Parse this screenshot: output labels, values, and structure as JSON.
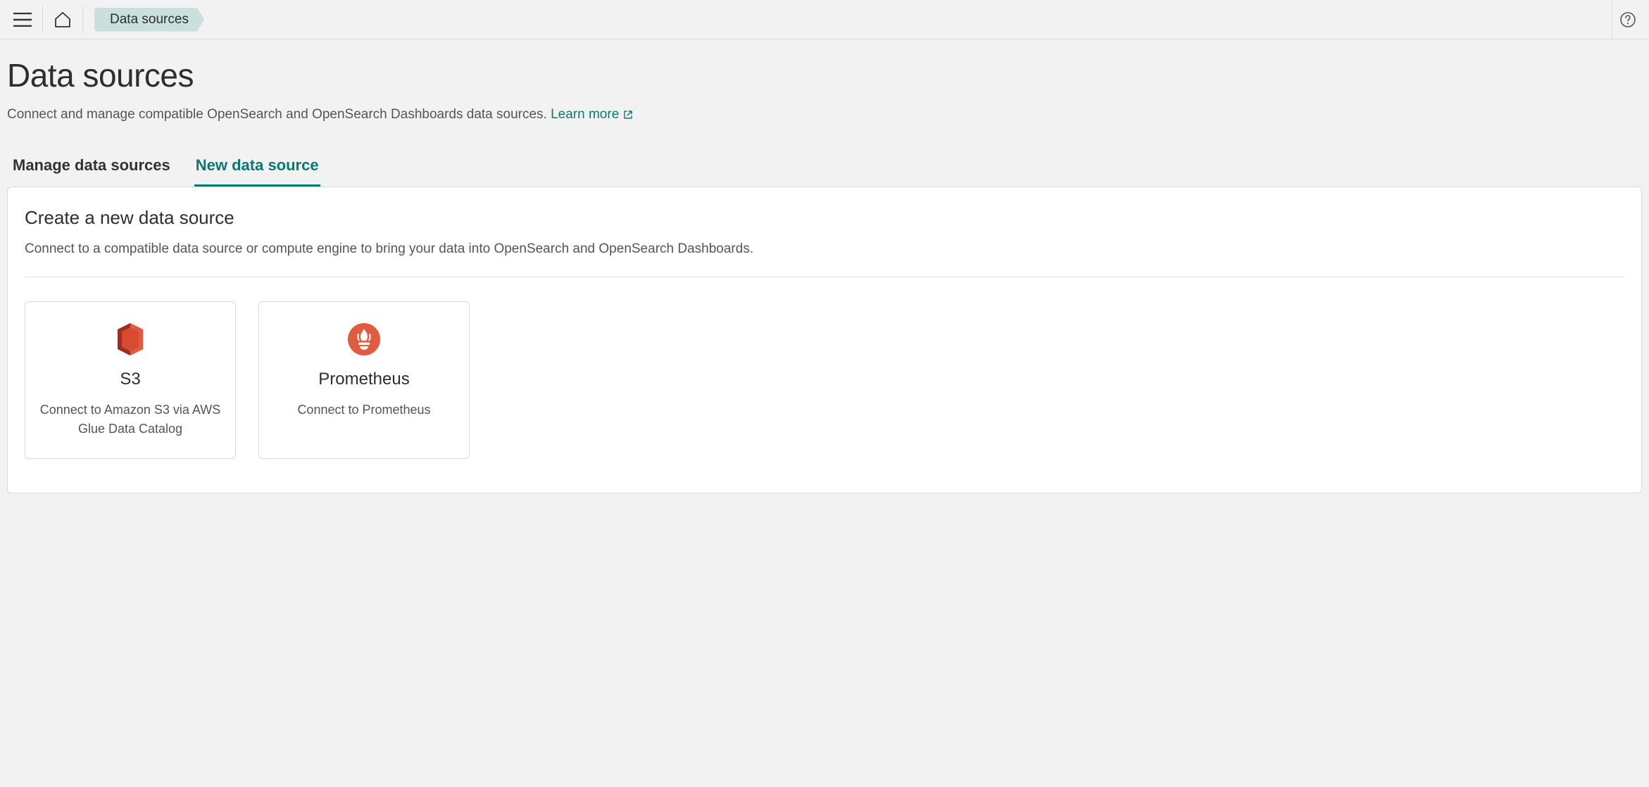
{
  "breadcrumb": {
    "current": "Data sources"
  },
  "page": {
    "title": "Data sources",
    "subtitle": "Connect and manage compatible OpenSearch and OpenSearch Dashboards data sources. ",
    "learn_more": "Learn more"
  },
  "tabs": [
    {
      "label": "Manage data sources",
      "active": false
    },
    {
      "label": "New data source",
      "active": true
    }
  ],
  "panel": {
    "title": "Create a new data source",
    "subtitle": "Connect to a compatible data source or compute engine to bring your data into OpenSearch and OpenSearch Dashboards."
  },
  "cards": [
    {
      "icon": "s3-icon",
      "title": "S3",
      "desc": "Connect to Amazon S3 via AWS Glue Data Catalog"
    },
    {
      "icon": "prometheus-icon",
      "title": "Prometheus",
      "desc": "Connect to Prometheus"
    }
  ]
}
